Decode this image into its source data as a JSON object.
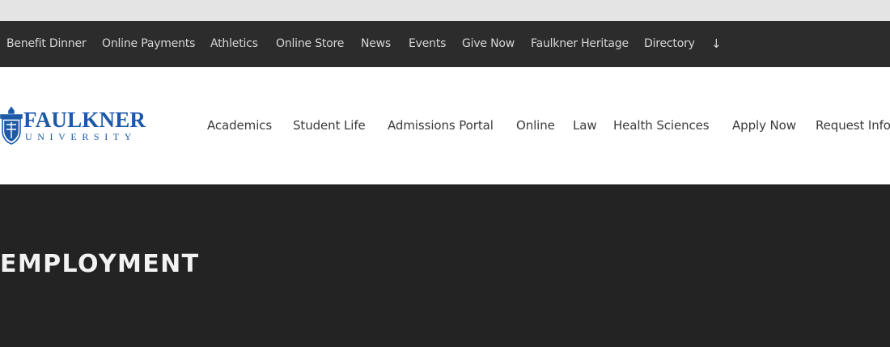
{
  "utility_nav": {
    "items": [
      "Benefit Dinner",
      "Online Payments",
      "Athletics",
      "Online Store",
      "News",
      "Events",
      "Give Now",
      "Faulkner Heritage",
      "Directory"
    ],
    "more_icon": "arrow-down-icon",
    "more_glyph": "↓"
  },
  "logo": {
    "name": "FAULKNER",
    "subtitle": "UNIVERSITY",
    "icon": "shield-crest-icon"
  },
  "main_nav": {
    "items": [
      "Academics",
      "Student Life",
      "Admissions Portal",
      "Online",
      "Law",
      "Health Sciences",
      "Apply Now",
      "Request Info"
    ]
  },
  "hero": {
    "title": "EMPLOYMENT"
  },
  "colors": {
    "brand_blue": "#1c5aa8",
    "utility_bar_bg": "#2c2c2c",
    "hero_bg": "#232323",
    "top_strip_bg": "#e4e4e4"
  }
}
